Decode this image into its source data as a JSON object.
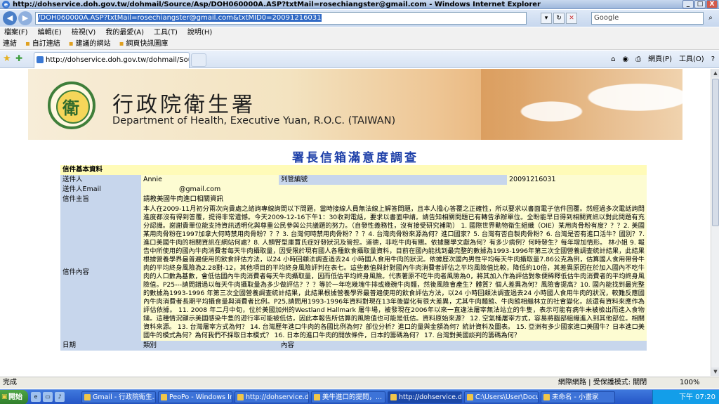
{
  "window": {
    "title": "http://dohservice.doh.gov.tw/dohmail/Source/Asp/DOH060000A.ASP?txtMail=rosechiangster@gmail.com - Windows Internet Explorer",
    "buttons": [
      "_",
      "□",
      "X"
    ]
  },
  "address_bar": {
    "url": "/DOH060000A.ASP?txtMail=rosechiangster@gmail.com&txtMID0=20091216031",
    "search_placeholder": "Google"
  },
  "menu": [
    "檔案(F)",
    "編輯(E)",
    "檢視(V)",
    "我的最愛(A)",
    "工具(T)",
    "說明(H)"
  ],
  "links_bar": {
    "label": "連結",
    "items": [
      "自訂連結",
      "建議的網站",
      "網頁快訊圖庫"
    ]
  },
  "tab": {
    "label": "http://dohservice.doh.gov.tw/dohmail/Source/Asp/DOH..."
  },
  "command_bar": [
    "網頁(P)",
    "工具(O)"
  ],
  "banner": {
    "org_zh": "行政院衛生署",
    "org_en": "Department of Health, Executive Yuan, R.O.C. (TAIWAN)"
  },
  "page": {
    "title": "署長信箱滿意度調查",
    "section": "信件基本資料",
    "fields": {
      "sender_label": "送件人",
      "sender_value": "Annie",
      "number_label": "列管編號",
      "number_value": "20091216031",
      "email_label": "送件人Email",
      "email_value": "@gmail.com",
      "subject_label": "信件主旨",
      "subject_value": "請教美國牛肉進口相關資訊",
      "content_label": "信件內容",
      "content_value": "本人在2009-11月初分兩次向貴處之諮詢專線詢問以下問題，當時接線人員無法線上解答問題，且本人擔心答覆之正確性，所以要求以書面電子信件回覆。然經過多次電話詢問進度都沒有得到答覆，提得非常遺憾。今天2009-12-16下午1：30收到電話，要求以書面申請。請告知相關問題已有轉告承辦單位。全盼能早日得到相關資訊以對此問題有充分認識。謝謝貴單位能支持資訊透明化與尊重公民參與公共議題的努力。（自發性義務性，沒有接受研究補助） 1. 國際世界動物衛生組織（OIE）某用肉骨粉有度？？？2. 美國某用肉骨粉在1997加拿大何時禁用肉骨粉？？？3. 台灣何時禁用肉骨粉？？？4. 台灣肉骨粉來源為何？進口國家？5. 台灣有否自製肉骨粉？6. 台灣是否有進口活牛？國別？7. 進口美國牛肉的相關資訊在網站何處？8. 人類腎型庫賈氏症好發狀況及管控。道德，非吃牛肉有關。依據醫學文獻為何？有多少病例？何時發生？每年增加情形。 林小姐 9. 報告中所使用的國內牛肉消費者每天牛肉攝取量，因受限於現有國人各種飲食攝取量資料，目前在國內能找到最完整的數據為1993-1996年第三次全國營養調查統計結果，此結果根據營養學界最普遍使用的飲食評估方法，以24 小時回顧法調查過去24 小時國人食用牛肉的狀況。依據歷次國內男性平均每天牛肉攝取量7.86公克為例，估算國人食用帶骨牛肉的平均終身風險為2.28對-12，其他項目的平均終身風險評判在表七。這些數值與針對國內牛肉消費者評估之平均風險值比較，降低約10倍，其差異原因在於加入國內不吃牛肉的人口數為基數，會低估國內牛肉消費者每天牛肉攝取量，因而低估平均終身風險。代表著原不吃牛肉者風險為0，將其加入作為評估對象便稀釋低估牛肉消費者的平均終身風險值。P25---請問錯過以每天牛肉攝取量為多少做評估？？？等於一年吃幾塊牛排或幾碗牛肉麵，然後風險會產生？體質？個人差異為何？風險會提高？10. 國內能找到最完整的數據為1993-1996 年第三次全國營養調查統計結果，此結果根據營養學界最普遍使用的飲食評估方法，以24 小時回顧法調查過去24 小時國人食用牛肉的狀況，較難反應國內牛肉消費者長期平均攝食量與消費者比例。P25,請問用1993-1996年資料對現在13年後變化有很大差異，尤其牛肉麵館、牛肉館相繼林立的社會變化，該還有資料來應作為評估依據。 11. 2008 年二月中旬，位於美國加州的Westland Hallmark 屠牛場，被發現在2006年以來一直違法屠宰無法站立的牛隻，表示可能有病牛未被檢出而進入食物鏈。這種情況顯示美國感染牛隻的遊行率可能被低估，因此本報告所估算的風險值也可能是低估。資料原始來源？ 12. 空氣桶屠宰方式，容易將腦部組織進入到其他部位。相關資料來源。 13. 台灣屠宰方式為何？ 14. 台灣歷年進口牛肉的各國比例為何？部位分析？進口的量與金額為何？統計資料及圖表。 15. 亞洲有多少國家進口美國牛？日本進口美國牛的模式為何？為何我們不採取日本模式？ 16. 日本的進口牛肉的開放條件，日本的籌碼為何？ 17. 台灣對美國談判的籌碼為何？",
      "date_label": "日期",
      "category_label": "類別",
      "detail_label": "內容"
    }
  },
  "status": {
    "left": "完成",
    "zone": "網際網路 | 受保護模式: 關閉",
    "zoom": "100%"
  },
  "taskbar": {
    "start": "開始",
    "tasks": [
      "Gmail - 行政院衛生...",
      "PeoPo - Windows Inte...",
      "http://dohservice.doh.g...",
      "美牛進口的提問，...",
      "http://dohservice.doh.g...",
      "C:\\Users\\User\\Docume...",
      "未命名 - 小畫家"
    ],
    "clock": "下午 07:20"
  }
}
